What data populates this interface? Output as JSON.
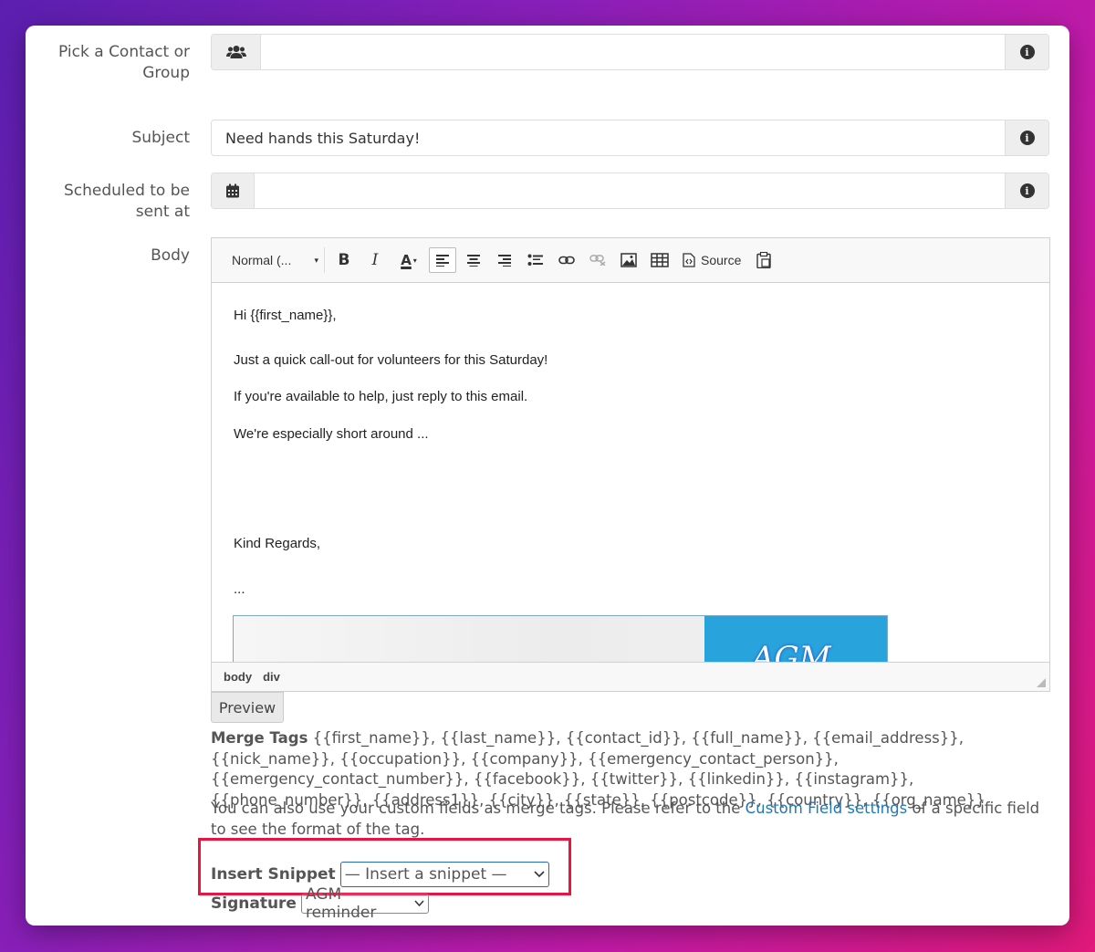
{
  "form": {
    "contact_label": "Pick a Contact or Group",
    "contact_value": "",
    "subject_label": "Subject",
    "subject_value": "Need hands this Saturday!",
    "scheduled_label": "Scheduled to be sent at",
    "scheduled_value": "",
    "body_label": "Body"
  },
  "toolbar": {
    "format_label": "Normal (...",
    "bold": "B",
    "italic": "I",
    "font_color": "A",
    "source_label": "Source"
  },
  "body": {
    "lines": [
      "Hi {{first_name}},",
      "Just a quick call-out for volunteers for this Saturday!",
      "If you're available to help, just reply to this email.",
      "We're especially short around ...",
      "Kind Regards,",
      "..."
    ],
    "image_text": "AGM"
  },
  "statusbar": {
    "path": [
      "body",
      "div"
    ]
  },
  "preview_label": "Preview",
  "merge_tags": {
    "label": "Merge Tags",
    "text": "{{first_name}}, {{last_name}}, {{contact_id}}, {{full_name}}, {{email_address}}, {{nick_name}}, {{occupation}}, {{company}}, {{emergency_contact_person}}, {{emergency_contact_number}}, {{facebook}}, {{twitter}}, {{linkedin}}, {{instagram}}, {{phone_number}}, {{address1}}, {{city}}, {{state}}, {{postcode}}, {{country}}, {{org_name}}"
  },
  "note": {
    "before": "You can also use your custom fields as merge tags. Please refer to the ",
    "link": "Custom Field settings",
    "after": " of a specific field to see the format of the tag."
  },
  "snippet": {
    "label": "Insert Snippet",
    "selected": "— Insert a snippet —"
  },
  "signature": {
    "label": "Signature",
    "selected": "AGM reminder"
  },
  "colors": {
    "highlight": "#e8163f",
    "link": "#2278b5",
    "focus": "#2766c9"
  }
}
